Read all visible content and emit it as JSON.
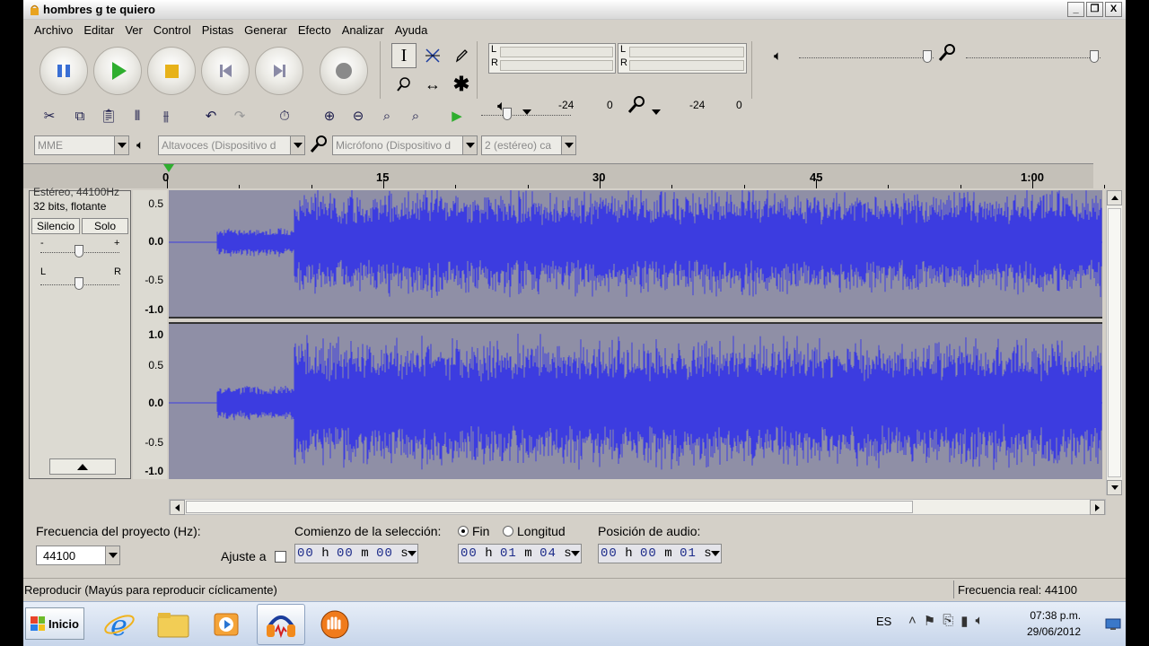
{
  "window": {
    "title": "hombres g te quiero",
    "minimize": "_",
    "restore": "❐",
    "close": "X"
  },
  "menu": [
    "Archivo",
    "Editar",
    "Ver",
    "Control",
    "Pistas",
    "Generar",
    "Efecto",
    "Analizar",
    "Ayuda"
  ],
  "meters": {
    "left_label": "L",
    "right_label": "R",
    "playback_scale": [
      "-24",
      "0"
    ],
    "record_scale": [
      "-24",
      "0"
    ]
  },
  "device": {
    "host": "MME",
    "output": "Altavoces (Dispositivo d",
    "input": "Micrófono (Dispositivo d",
    "channels": "2 (estéreo) ca"
  },
  "ruler": {
    "labels": [
      "0",
      "15",
      "30",
      "45",
      "1:00"
    ]
  },
  "track": {
    "partial_name": "Estéreo, 44100Hz",
    "format": "32 bits, flotante",
    "mute_label": "Silencio",
    "solo_label": "Solo",
    "gain_minus": "-",
    "gain_plus": "+",
    "pan_left": "L",
    "pan_right": "R",
    "channel1_scale": [
      "0.5",
      "0.0",
      "-0.5",
      "-1.0"
    ],
    "channel2_scale": [
      "1.0",
      "0.5",
      "0.0",
      "-0.5",
      "-1.0"
    ],
    "wave_color": "#3c3ce0",
    "wave_bg": "#8f8fa6"
  },
  "selection": {
    "rate_label": "Frecuencia del proyecto (Hz):",
    "rate_value": "44100",
    "snap_label": "Ajuste a",
    "start_label": "Comienzo de la selección:",
    "end_label": "Fin",
    "length_label": "Longitud",
    "position_label": "Posición de audio:",
    "start_time": {
      "h": "00",
      "m": "00",
      "s": "00"
    },
    "end_time": {
      "h": "00",
      "m": "01",
      "s": "04"
    },
    "position_time": {
      "h": "00",
      "m": "00",
      "s": "01"
    },
    "unit_h": "h",
    "unit_m": "m",
    "unit_s": "s"
  },
  "status": {
    "left": "Reproducir (Mayús para reproducir cíclicamente)",
    "right": "Frecuencia real: 44100"
  },
  "taskbar": {
    "start_label": "Inicio",
    "language": "ES",
    "time": "07:38 p.m.",
    "date": "29/06/2012"
  }
}
